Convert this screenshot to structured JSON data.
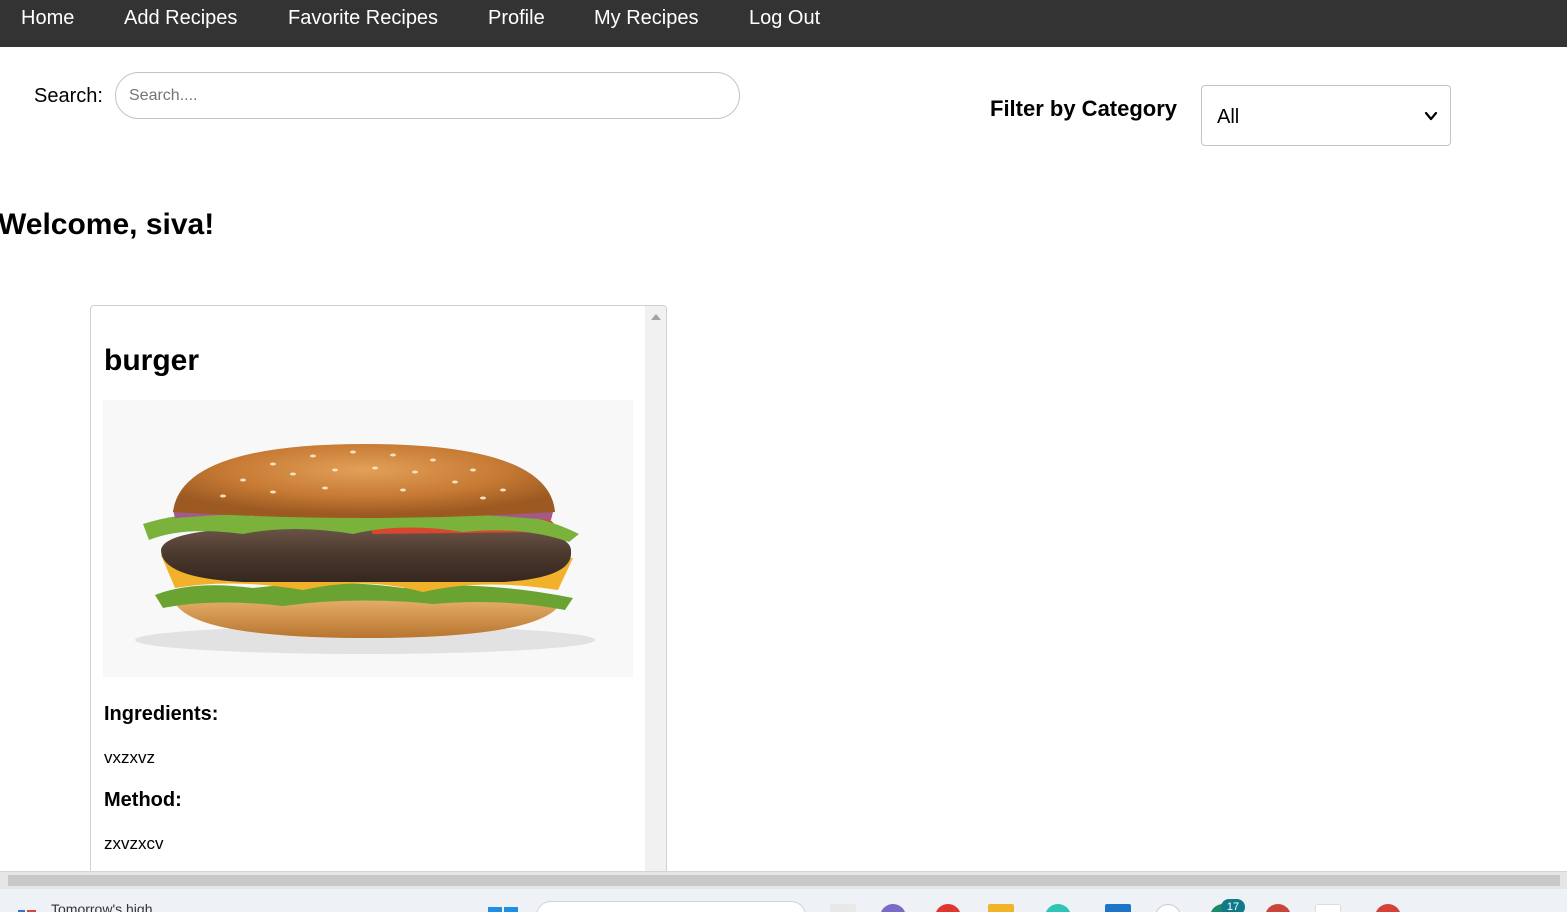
{
  "nav": {
    "items": [
      {
        "label": "Home"
      },
      {
        "label": "Add Recipes"
      },
      {
        "label": "Favorite Recipes"
      },
      {
        "label": "Profile"
      },
      {
        "label": "My Recipes"
      },
      {
        "label": "Log Out"
      }
    ],
    "background": "#333333"
  },
  "search": {
    "label": "Search:",
    "placeholder": "Search....",
    "value": ""
  },
  "filter": {
    "label": "Filter by Category",
    "selected": "All"
  },
  "welcome": "Welcome, siva!",
  "recipe": {
    "title": "burger",
    "image_icon": "burger-photo",
    "ingredients_label": "Ingredients:",
    "ingredients": "vxzxvz",
    "method_label": "Method:",
    "method": "zxvzxcv"
  },
  "taskbar": {
    "weather_text": "Tomorrow's high",
    "notification_count": "17"
  }
}
